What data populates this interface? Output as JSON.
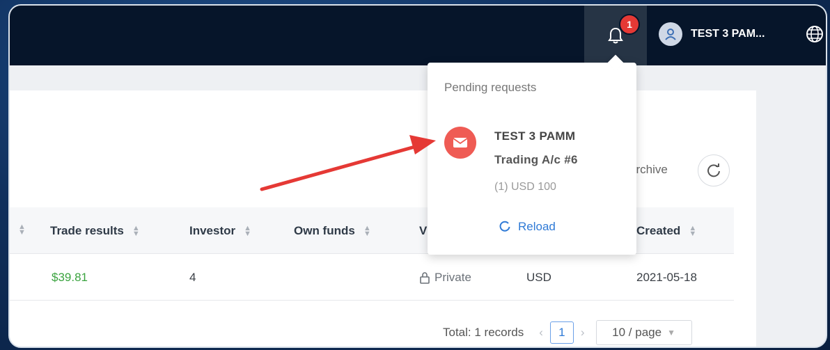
{
  "header": {
    "notifications_count": "1",
    "user_name": "TEST 3 PAM..."
  },
  "toolbar": {
    "archive_label": "archive"
  },
  "table": {
    "columns": [
      "Trade results",
      "Investor",
      "Own funds",
      "V",
      "Created"
    ],
    "row": {
      "trade_results": "$39.81",
      "investor": "4",
      "visibility": "Private",
      "currency": "USD",
      "created": "2021-05-18"
    }
  },
  "pagination": {
    "total": "Total: 1 records",
    "current_page": "1",
    "page_size": "10 / page"
  },
  "popover": {
    "title": "Pending requests",
    "request": {
      "name": "TEST 3 PAMM",
      "account": "Trading A/c #6",
      "amount": "(1) USD 100"
    },
    "reload_label": "Reload"
  },
  "colors": {
    "topbar": "#06152a",
    "accent_blue": "#2f7ad6",
    "badge_red": "#e53935",
    "mail_red": "#ef5b54",
    "profit_green": "#3aa33f",
    "annotation_arrow": "#e53935"
  }
}
